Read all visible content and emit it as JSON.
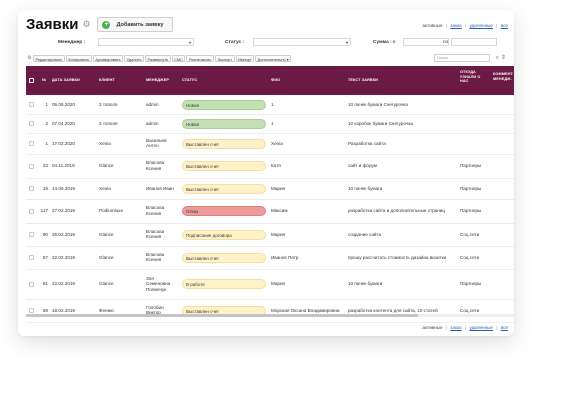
{
  "page": {
    "title": "Заявки",
    "add_button_label": "Добавить заявку"
  },
  "top_filters": {
    "active": "активные",
    "links": [
      "заказ",
      "удаленные",
      "все"
    ]
  },
  "filters": {
    "manager_label": "Менеджер :",
    "status_label": "Статус :",
    "sum_label": "Сумма : с",
    "sum_to": "по"
  },
  "toolbar": {
    "buttons": [
      "Редактировать",
      "Копировать",
      "Архивировать",
      "Удалить",
      "Развернуть",
      "СМС",
      "Распечатать",
      "Экспорт",
      "Импорт",
      "Дополнительно ▾"
    ],
    "search_placeholder": "Поиск"
  },
  "columns": [
    "№",
    "Дата заявки",
    "Клиент",
    "Менеджер",
    "Статус",
    "ФИО",
    "Текст заявки",
    "Откуда узнали о нас",
    "Коммент. менедж."
  ],
  "rows": [
    {
      "id": "1",
      "date": "05.06.2020",
      "client": "3 тополя",
      "manager": "admin",
      "status": "Новая",
      "status_color": "#c5e0b4",
      "status_border": "#a9cf93",
      "fio": "1",
      "text": "10 пачек бумаги Снегурочка",
      "source": ""
    },
    {
      "id": "2",
      "date": "07.04.2020",
      "client": "3 тополя",
      "manager": "admin",
      "status": "Новая",
      "status_color": "#c5e0b4",
      "status_border": "#a9cf93",
      "fio": "1",
      "text": "10 коробок бумаги Снегурочка",
      "source": ""
    },
    {
      "id": "1",
      "date": "17.02.2020",
      "client": "Xenia",
      "manager": "Васильев Антон",
      "status": "Выставлен счет",
      "status_color": "#fff2c8",
      "status_border": "#f1dfa3",
      "fio": "Xenia",
      "text": "Разработка сайта",
      "source": ""
    },
    {
      "id": "23",
      "date": "04.11.2019",
      "client": "Glance",
      "manager": "Власова Ксения",
      "status": "Выставлен счет",
      "status_color": "#fff2c8",
      "status_border": "#f1dfa3",
      "fio": "Катя",
      "text": "сайт и форум",
      "source": "Партнеры"
    },
    {
      "id": "19",
      "date": "14.09.2019",
      "client": "Xenia",
      "manager": "Иванов Иван",
      "status": "Выставлен счет",
      "status_color": "#fff2c8",
      "status_border": "#f1dfa3",
      "fio": "Мария",
      "text": "10 пачек бумаги",
      "source": "Партнеры"
    },
    {
      "id": "117",
      "date": "27.02.2019",
      "client": "Podiumluxe",
      "manager": "Власова Ксения",
      "status": "Отказ",
      "status_color": "#ec9a9a",
      "status_border": "#de8080",
      "fio": "Максим",
      "text": "разработка сайта и дополнительные страниц",
      "source": "Партнеры"
    },
    {
      "id": "90",
      "date": "26.02.2019",
      "client": "Glance",
      "manager": "Власова Ксения",
      "status": "Подписание договора",
      "status_color": "#fff2c8",
      "status_border": "#f1dfa3",
      "fio": "Мария",
      "text": "создание сайта",
      "source": "Соц.сети"
    },
    {
      "id": "87",
      "date": "22.02.2019",
      "client": "Glance",
      "manager": "Власова Ксения",
      "status": "Выставлен счет",
      "status_color": "#fff2c8",
      "status_border": "#f1dfa3",
      "fio": "Иванов Петр",
      "text": "прошу рассчитать стоимость дизайна визитки",
      "source": "Соц.сети"
    },
    {
      "id": "81",
      "date": "22.02.2019",
      "client": "Glance",
      "manager": "Зоя Семеновна Полинчук",
      "status": "В работе",
      "status_color": "#fff2c8",
      "status_border": "#f1dfa3",
      "fio": "Мария",
      "text": "10 пачек бумаги",
      "source": "Партнеры"
    },
    {
      "id": "58",
      "date": "18.02.2019",
      "client": "Феникс",
      "manager": "Голобин Виктор",
      "status": "Выставлен счет",
      "status_color": "#fff2c8",
      "status_border": "#f1dfa3",
      "fio": "Морская Оксана Владимировна",
      "text": "разработка контента для сайта, 10 статей",
      "source": "Соц.сети"
    }
  ],
  "bottom_filters": {
    "active": "активные",
    "links": [
      "заказ",
      "удаленные",
      "все"
    ]
  },
  "colors": {
    "header_bg": "#6b1a46",
    "link": "#2a5db0",
    "add_icon": "#4caf50"
  }
}
